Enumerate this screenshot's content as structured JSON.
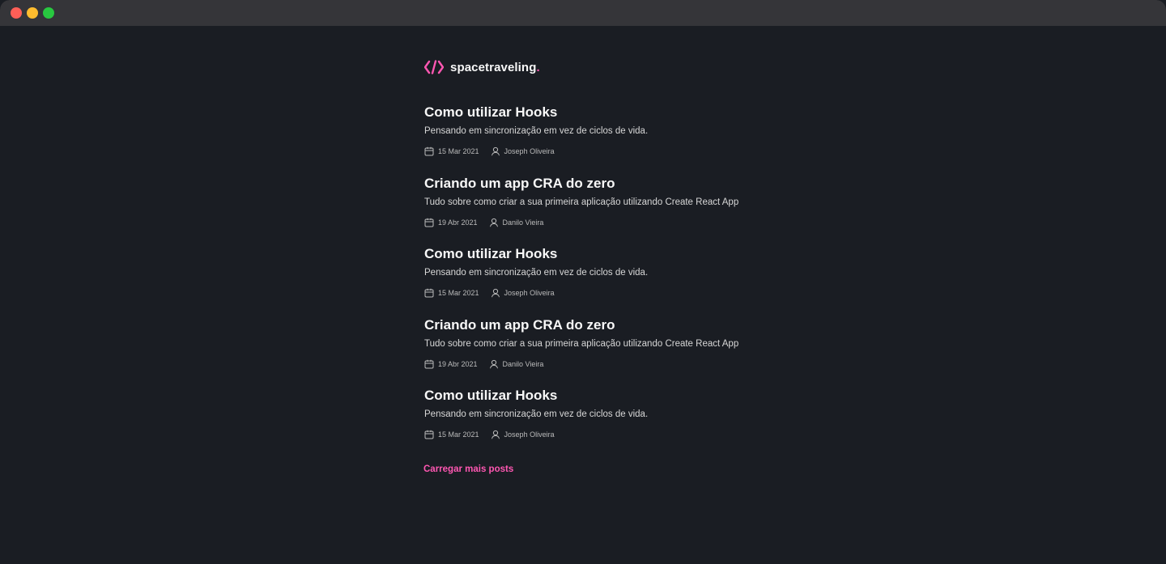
{
  "brand": {
    "name": "spacetraveling",
    "dot": ".",
    "accent_color": "#ff57b2"
  },
  "posts": [
    {
      "title": "Como utilizar Hooks",
      "subtitle": "Pensando em sincronização em vez de ciclos de vida.",
      "date": "15 Mar 2021",
      "author": "Joseph Oliveira"
    },
    {
      "title": "Criando um app CRA do zero",
      "subtitle": "Tudo sobre como criar a sua primeira aplicação utilizando Create React App",
      "date": "19 Abr 2021",
      "author": "Danilo Vieira"
    },
    {
      "title": "Como utilizar Hooks",
      "subtitle": "Pensando em sincronização em vez de ciclos de vida.",
      "date": "15 Mar 2021",
      "author": "Joseph Oliveira"
    },
    {
      "title": "Criando um app CRA do zero",
      "subtitle": "Tudo sobre como criar a sua primeira aplicação utilizando Create React App",
      "date": "19 Abr 2021",
      "author": "Danilo Vieira"
    },
    {
      "title": "Como utilizar Hooks",
      "subtitle": "Pensando em sincronização em vez de ciclos de vida.",
      "date": "15 Mar 2021",
      "author": "Joseph Oliveira"
    }
  ],
  "load_more": {
    "label": "Carregar mais posts"
  },
  "icons": {
    "logo": "code-brackets-icon",
    "date": "calendar-icon",
    "author": "user-icon"
  }
}
